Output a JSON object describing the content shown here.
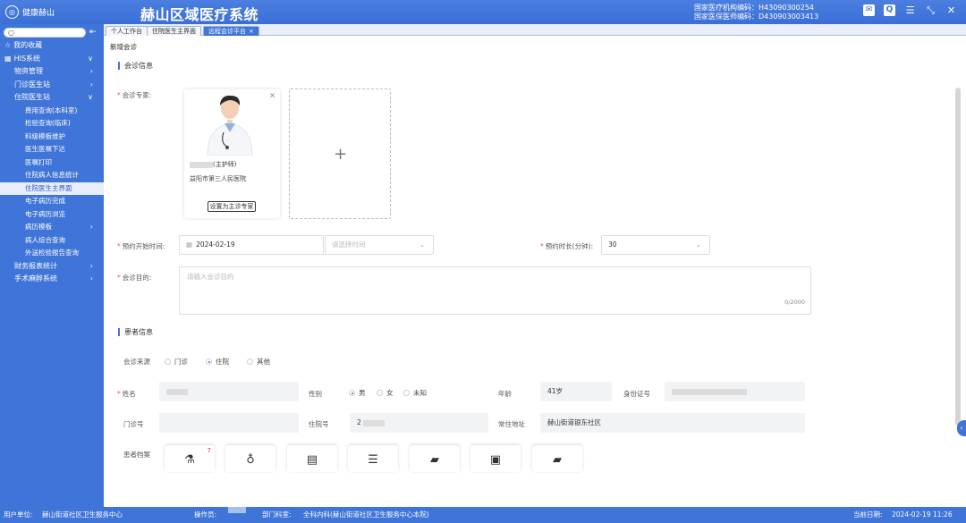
{
  "header": {
    "logo_text": "健康赫山",
    "app_title": "赫山区域医疗系统",
    "org_code_label": "国家医疗机构编码：",
    "org_code": "H43090300254",
    "doctor_code_label": "国家医保医师编码：",
    "doctor_code": "D430903003413"
  },
  "sidebar": {
    "search_placeholder": "",
    "items": [
      {
        "label": "我的收藏",
        "level": 0,
        "lead": "☆",
        "arrow": ""
      },
      {
        "label": "HIS系统",
        "level": 0,
        "lead": "▦",
        "arrow": "∨"
      },
      {
        "label": "物资管理",
        "level": 1,
        "arrow": "›"
      },
      {
        "label": "门诊医生站",
        "level": 1,
        "arrow": "›"
      },
      {
        "label": "住院医生站",
        "level": 1,
        "arrow": "∨"
      },
      {
        "label": "费用查询(本科室)",
        "level": 2,
        "arrow": ""
      },
      {
        "label": "检验查询(临床)",
        "level": 2,
        "arrow": ""
      },
      {
        "label": "科级模板维护",
        "level": 2,
        "arrow": ""
      },
      {
        "label": "医生医嘱下达",
        "level": 2,
        "arrow": ""
      },
      {
        "label": "医嘱打印",
        "level": 2,
        "arrow": ""
      },
      {
        "label": "住院病人信息统计",
        "level": 2,
        "arrow": ""
      },
      {
        "label": "住院医生主界面",
        "level": 2,
        "arrow": "",
        "active": true
      },
      {
        "label": "电子病历完成",
        "level": 2,
        "arrow": ""
      },
      {
        "label": "电子病历浏览",
        "level": 2,
        "arrow": ""
      },
      {
        "label": "病历模板",
        "level": 2,
        "arrow": "›"
      },
      {
        "label": "病人综合查询",
        "level": 2,
        "arrow": ""
      },
      {
        "label": "外送检验报告查询",
        "level": 2,
        "arrow": ""
      },
      {
        "label": "财务报表统计",
        "level": 1,
        "arrow": "›"
      },
      {
        "label": "手术麻醉系统",
        "level": 1,
        "arrow": "›"
      }
    ]
  },
  "tabs": [
    {
      "label": "个人工作台"
    },
    {
      "label": "住院医生主界面"
    },
    {
      "label": "远程会诊平台",
      "close": "×"
    }
  ],
  "page": {
    "title": "新增会诊",
    "section_consult": "会诊信息",
    "expert_label": "会诊专家:",
    "expert_card": {
      "close": "×",
      "title_suffix": "(主护师)",
      "hospital": "益阳市第三人民医院",
      "set_main_button": "设置为主诊专家"
    },
    "add_symbol": "+",
    "start_time_label": "预约开始时间:",
    "start_date": "2024-02-19",
    "time_placeholder": "请选择时间",
    "duration_label": "预约时长(分钟):",
    "duration_value": "30",
    "purpose_label": "会诊目的:",
    "purpose_placeholder": "请输入会诊目的",
    "purpose_count": "0/2000",
    "section_patient": "患者信息",
    "source_label": "会诊来源",
    "source_options": [
      "门诊",
      "住院",
      "其他"
    ],
    "name_label": "姓名",
    "gender_label": "性别",
    "gender_options": [
      "男",
      "女",
      "未知"
    ],
    "age_label": "年龄",
    "age_value": "41岁",
    "id_label": "身份证号",
    "outpatient_label": "门诊号",
    "inpatient_label": "住院号",
    "inpatient_prefix": "2",
    "address_label": "常住地址",
    "address_value": "赫山街道银东社区",
    "archive_label": "患者档案",
    "archive_badge": "7"
  },
  "statusbar": {
    "unit_label": "用户单位:",
    "unit_value": "赫山街道社区卫生服务中心",
    "operator_label": "操作员:",
    "dept_label": "部门科室:",
    "dept_value": "全科内科(赫山街道社区卫生服务中心本院)",
    "date_label": "当前日期:",
    "date_value": "2024-02-19 11:26"
  }
}
